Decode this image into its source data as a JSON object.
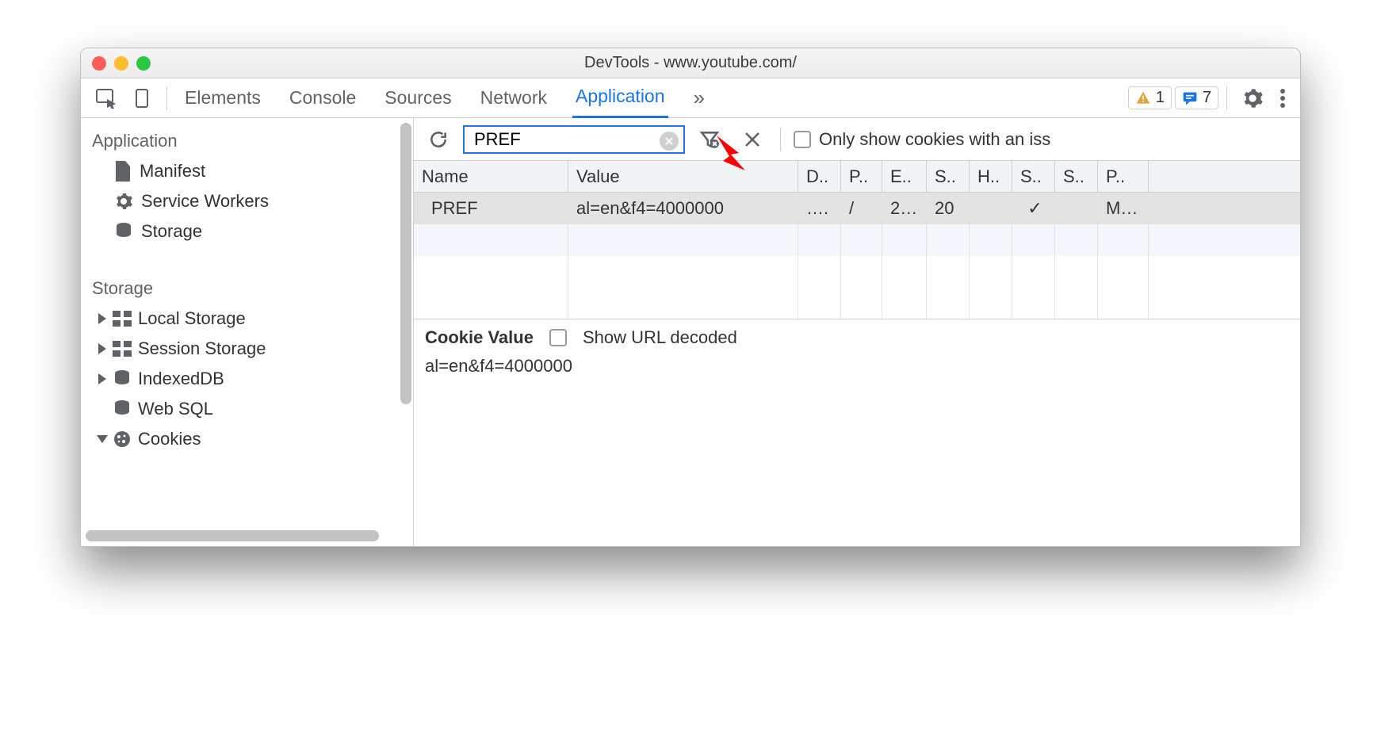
{
  "window": {
    "title": "DevTools - www.youtube.com/"
  },
  "tabs": {
    "items": [
      "Elements",
      "Console",
      "Sources",
      "Network",
      "Application"
    ],
    "more_icon": "»",
    "active_index": 4
  },
  "badges": {
    "warnings": "1",
    "messages": "7"
  },
  "sidebar": {
    "groups": [
      {
        "label": "Application",
        "items": [
          {
            "icon": "file-icon",
            "label": "Manifest"
          },
          {
            "icon": "gear-icon",
            "label": "Service Workers"
          },
          {
            "icon": "db-icon",
            "label": "Storage"
          }
        ]
      },
      {
        "label": "Storage",
        "items": [
          {
            "icon": "table-icon",
            "label": "Local Storage",
            "expandable": true
          },
          {
            "icon": "table-icon",
            "label": "Session Storage",
            "expandable": true
          },
          {
            "icon": "db-icon",
            "label": "IndexedDB",
            "expandable": true
          },
          {
            "icon": "db-icon",
            "label": "Web SQL"
          },
          {
            "icon": "cookie-icon",
            "label": "Cookies",
            "expanded": true
          }
        ]
      }
    ]
  },
  "filter": {
    "value": "PREF",
    "only_issue_label": "Only show cookies with an iss"
  },
  "cookies": {
    "columns": [
      "Name",
      "Value",
      "D..",
      "P..",
      "E..",
      "S..",
      "H..",
      "S..",
      "S..",
      "P.."
    ],
    "rows": [
      {
        "name": "PREF",
        "value": "al=en&f4=4000000",
        "d": "….",
        "p": "/",
        "e": "2…",
        "s": "20",
        "h": "",
        "s2": "✓",
        "s3": "",
        "p2": "M…"
      }
    ]
  },
  "detail": {
    "heading": "Cookie Value",
    "checkbox_label": "Show URL decoded",
    "value": "al=en&f4=4000000"
  }
}
